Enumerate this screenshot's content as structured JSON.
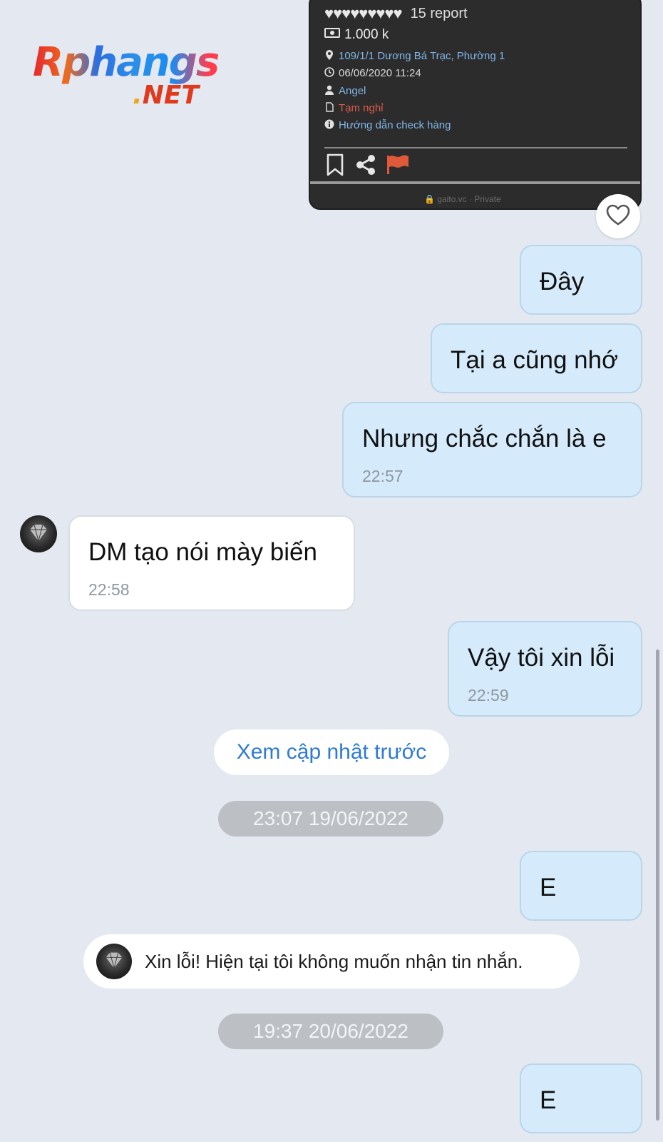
{
  "watermark": {
    "brand": "Rphangs",
    "domain_dot": ".",
    "domain": "NET"
  },
  "shared_post": {
    "report_label": "15 report",
    "hearts_count": 9,
    "price": "1.000 k",
    "address": "109/1/1 Dương Bá Trạc, Phường 1",
    "datetime": "06/06/2020 11:24",
    "user": "Angel",
    "status": "Tạm nghỉ",
    "guide": "Hướng dẫn check hàng",
    "footer": "🔒 gaito.vc · Private",
    "colors": {
      "link": "#7fb6e8",
      "status": "#e05a4a",
      "flag": "#e05a3a"
    }
  },
  "messages": [
    {
      "side": "out",
      "text": "Đây",
      "time": ""
    },
    {
      "side": "out",
      "text": "Tại a cũng nhớ",
      "time": ""
    },
    {
      "side": "out",
      "text": "Nhưng chắc chắn là e",
      "time": "22:57"
    },
    {
      "side": "in",
      "text": "DM tạo nói mày biến",
      "time": "22:58"
    },
    {
      "side": "out",
      "text": "Vậy tôi xin lỗi",
      "time": "22:59"
    },
    {
      "side": "out",
      "text": "E",
      "time": ""
    },
    {
      "side": "out",
      "text": "E",
      "time": ""
    }
  ],
  "load_previous_label": "Xem cập nhật trước",
  "date_separators": [
    "23:07 19/06/2022",
    "19:37 20/06/2022"
  ],
  "system_notice": "Xin lỗi! Hiện tại tôi không muốn nhận tin nhắn.",
  "colors": {
    "outgoing_bubble": "#d5ebfb",
    "incoming_bubble": "#ffffff",
    "background": "#e3e8f1",
    "accent_link": "#2f7bd0"
  }
}
